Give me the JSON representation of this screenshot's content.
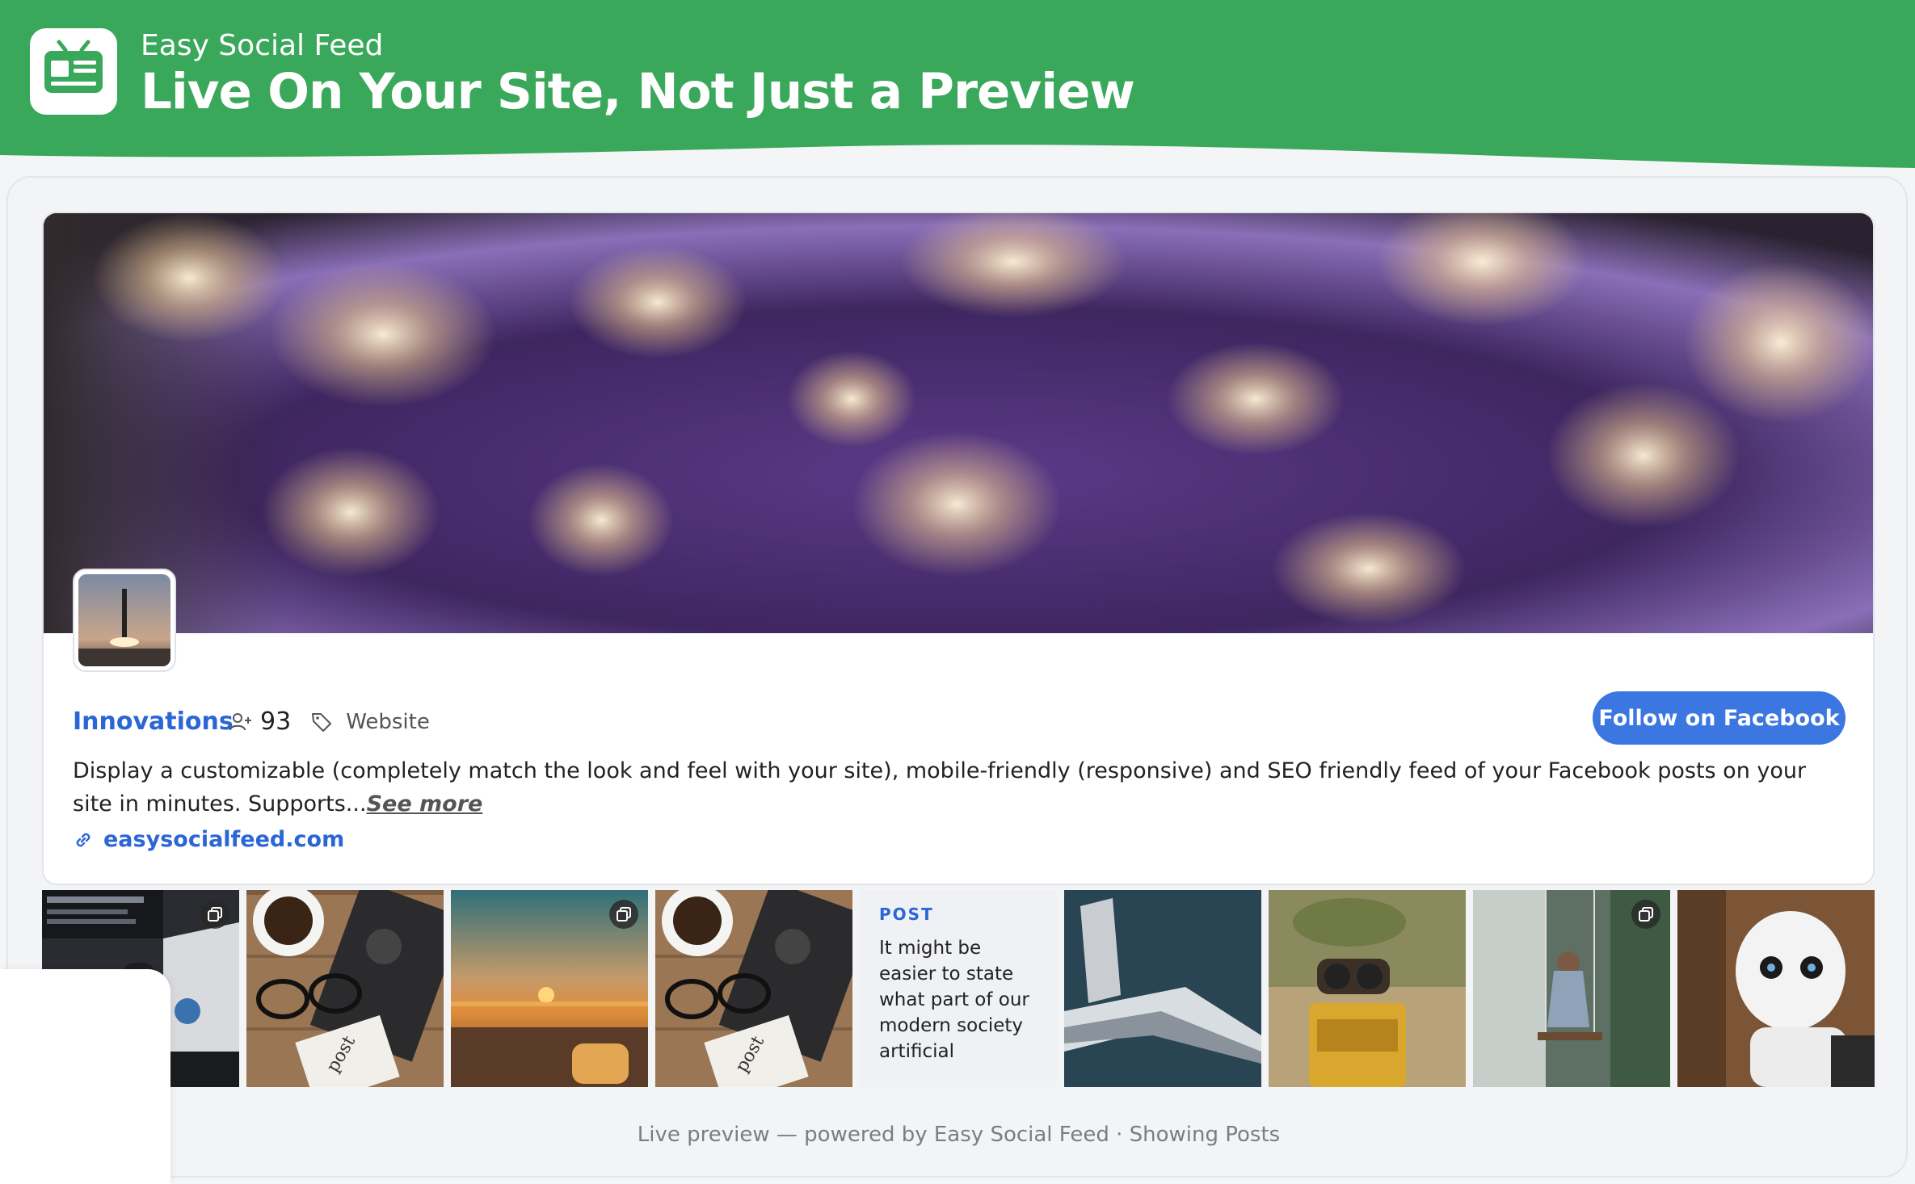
{
  "header": {
    "brand": "Easy Social Feed",
    "headline": "Live On Your Site, Not Just a Preview",
    "logo_icon": "news-tv-icon",
    "bg_color": "#3aa85a"
  },
  "page": {
    "name": "Innovations",
    "followers": "93",
    "category": "Website",
    "follow_label": "Follow on Facebook",
    "about": "Display a customizable (completely match the look and feel with your site), mobile-friendly (responsive) and SEO friendly feed of your Facebook posts on your site in minutes. Supports...",
    "see_more": "See more",
    "website": "easysocialfeed.com",
    "accent": "#3b76e1"
  },
  "thumbs": [
    {
      "kind": "image",
      "subject": "car-dashboard",
      "multi": true
    },
    {
      "kind": "image",
      "subject": "coffee-glasses-note",
      "multi": false
    },
    {
      "kind": "image",
      "subject": "sunset-jar",
      "multi": true
    },
    {
      "kind": "image",
      "subject": "coffee-glasses-note",
      "multi": false
    },
    {
      "kind": "text",
      "label": "POST",
      "text": "It might be easier to state what part of our modern society artificial"
    },
    {
      "kind": "image",
      "subject": "futuristic-boat",
      "multi": false
    },
    {
      "kind": "image",
      "subject": "robot-figure",
      "multi": false
    },
    {
      "kind": "image",
      "subject": "waterfall-swing",
      "multi": true
    },
    {
      "kind": "image",
      "subject": "humanoid-robot",
      "multi": false
    }
  ],
  "footer": {
    "text": "Live preview — powered by Easy Social Feed · Showing Posts"
  }
}
